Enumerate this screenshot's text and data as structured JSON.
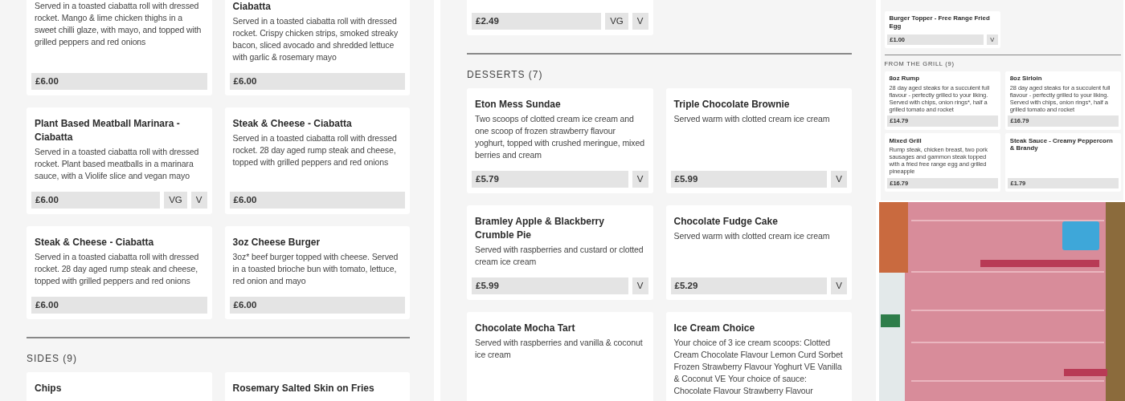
{
  "panels": [
    {
      "kind": "page",
      "blocks": [
        {
          "kind": "cards",
          "cards": [
            {
              "description": "Served in a toasted ciabatta roll with dressed rocket. Mango & lime chicken thighs in a sweet chilli glaze, with mayo, and topped with grilled peppers and red onions",
              "price": "£6.00"
            },
            {
              "title": "Ciabatta",
              "description": "Served in a toasted ciabatta roll with dressed rocket. Crispy chicken strips, smoked streaky bacon, sliced avocado and shredded lettuce with garlic & rosemary mayo",
              "price": "£6.00"
            },
            {
              "title": "Plant Based Meatball Marinara - Ciabatta",
              "description": "Served in a toasted ciabatta roll with dressed rocket. Plant based meatballs in a marinara sauce, with a Violife slice and vegan mayo",
              "price": "£6.00",
              "tags": [
                "VG",
                "V"
              ]
            },
            {
              "title": "Steak & Cheese - Ciabatta",
              "description": "Served in a toasted ciabatta roll with dressed rocket. 28 day aged rump steak and cheese, topped with grilled peppers and red onions",
              "price": "£6.00"
            },
            {
              "title": "Steak & Cheese - Ciabatta",
              "description": "Served in a toasted ciabatta roll with dressed rocket. 28 day aged rump steak and cheese, topped with grilled peppers and red onions",
              "price": "£6.00"
            },
            {
              "title": "3oz Cheese Burger",
              "description": "3oz* beef burger topped with cheese. Served in a toasted brioche bun with tomato, lettuce, red onion and mayo",
              "price": "£6.00"
            }
          ]
        },
        {
          "kind": "heading",
          "text": "SIDES (9)"
        },
        {
          "kind": "cards",
          "cards": [
            {
              "title": "Chips"
            },
            {
              "title": "Rosemary Salted Skin on Fries"
            }
          ]
        }
      ]
    },
    {
      "kind": "page",
      "blocks": [
        {
          "kind": "cards",
          "cards": [
            {
              "price": "£2.49",
              "tags": [
                "VG",
                "V"
              ]
            }
          ]
        },
        {
          "kind": "heading",
          "text": "DESSERTS (7)"
        },
        {
          "kind": "cards",
          "cards": [
            {
              "title": "Eton Mess Sundae",
              "description": "Two scoops of clotted cream ice cream and one scoop of frozen strawberry flavour yoghurt, topped with crushed meringue, mixed berries and cream",
              "price": "£5.79",
              "tags": [
                "V"
              ]
            },
            {
              "title": "Triple Chocolate Brownie",
              "description": "Served warm with clotted cream ice cream",
              "price": "£5.99",
              "tags": [
                "V"
              ]
            },
            {
              "title": "Bramley Apple & Blackberry Crumble Pie",
              "description": "Served with raspberries and custard or clotted cream ice cream",
              "price": "£5.99",
              "tags": [
                "V"
              ]
            },
            {
              "title": "Chocolate Fudge Cake",
              "description": "Served warm with clotted cream ice cream",
              "price": "£5.29",
              "tags": [
                "V"
              ]
            },
            {
              "title": "Chocolate Mocha Tart",
              "description": "Served with raspberries and vanilla & coconut ice cream"
            },
            {
              "title": "Ice Cream Choice",
              "description": "Your choice of 3 ice cream scoops: Clotted Cream Chocolate Flavour Lemon Curd Sorbet Frozen Strawberry Flavour Yoghurt VE Vanilla & Coconut VE Your choice of sauce: Chocolate Flavour Strawberry Flavour"
            }
          ]
        }
      ]
    },
    {
      "kind": "mini",
      "blocks": [
        {
          "kind": "cards",
          "cards": [
            {
              "title": "Burger Topper - Free Range Fried Egg",
              "price": "£1.00",
              "tags": [
                "V"
              ]
            }
          ]
        },
        {
          "kind": "heading",
          "text": "FROM THE GRILL (9)"
        },
        {
          "kind": "cards",
          "cards": [
            {
              "title": "8oz Rump",
              "description": "28 day aged steaks for a succulent full flavour - perfectly grilled to your liking. Served with chips, onion rings*, half a grilled tomato and rocket",
              "price": "£14.79"
            },
            {
              "title": "8oz Sirloin",
              "description": "28 day aged steaks for a succulent full flavour - perfectly grilled to your liking. Served with chips, onion rings*, half a grilled tomato and rocket",
              "price": "£16.79"
            },
            {
              "title": "Mixed Grill",
              "description": "Rump steak, chicken breast, two pork sausages and gammon steak topped with a fried free range egg and grilled pineapple",
              "price": "£16.79"
            },
            {
              "title": "Steak Sauce - Creamy Peppercorn & Brandy",
              "price": "£1.79"
            }
          ]
        }
      ]
    }
  ]
}
